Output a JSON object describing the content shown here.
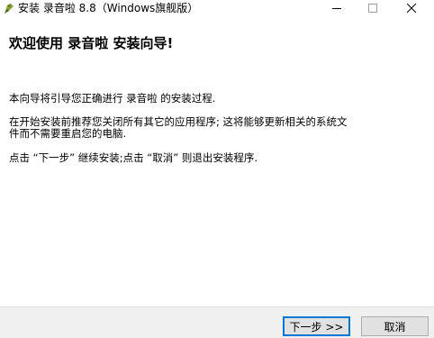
{
  "window": {
    "title": "安装 录音啦 8.8（Windows旗舰版）",
    "icon": "installer-app-icon"
  },
  "content": {
    "heading": "欢迎使用 录音啦 安装向导!",
    "paragraph1": "本向导将引导您正确进行 录音啦 的安装过程.",
    "paragraph2_line1": "在开始安装前推荐您关闭所有其它的应用程序; 这将能够更新相关的系统文",
    "paragraph2_line2": "件而不需要重启您的电脑.",
    "paragraph3": "点击 “下一步” 继续安装;点击 “取消” 则退出安装程序."
  },
  "buttons": {
    "next_label": "下一步 >>",
    "cancel_label": "取消"
  },
  "colors": {
    "accent": "#0078d7",
    "button_face": "#e1e1e1",
    "footer_bg": "#f0f0f0"
  }
}
